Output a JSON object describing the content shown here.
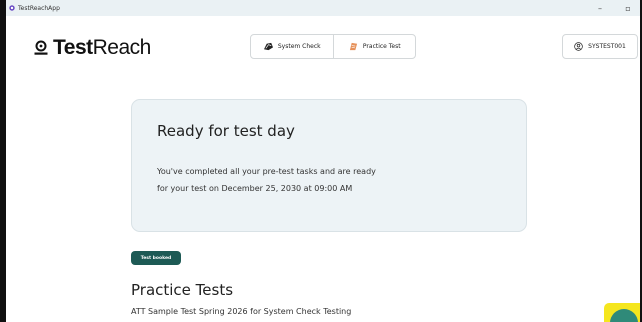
{
  "window": {
    "title": "TestReachApp",
    "minimize": "–",
    "maximize": "▫"
  },
  "header": {
    "logo_bold": "Test",
    "logo_light": "Reach",
    "nav": {
      "system_check": "System Check",
      "practice_test": "Practice Test"
    },
    "user": "SYSTEST001"
  },
  "card": {
    "title": "Ready for test day",
    "body": "You've completed all your pre-test tasks and are ready for your test on December 25, 2030 at 09:00 AM"
  },
  "badge": "Test booked",
  "practice": {
    "title": "Practice Tests",
    "items": [
      "ATT Sample Test Spring 2026 for System Check Testing"
    ]
  },
  "colors": {
    "accent": "#1d5a55",
    "card_bg": "#edf3f6",
    "chat": "#2f8a79",
    "chat_highlight": "#f5e61e"
  }
}
